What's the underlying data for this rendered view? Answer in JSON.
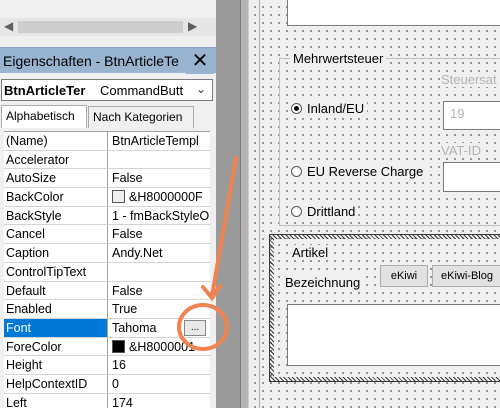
{
  "properties_panel": {
    "title": "Eigenschaften - BtnArticleTe",
    "object_name": "BtnArticleTer",
    "object_type": "CommandButt",
    "tabs": [
      "Alphabetisch",
      "Nach Kategorien"
    ],
    "rows": [
      {
        "name": "(Name)",
        "value": "BtnArticleTempl"
      },
      {
        "name": "Accelerator",
        "value": ""
      },
      {
        "name": "AutoSize",
        "value": "False"
      },
      {
        "name": "BackColor",
        "value": "&H8000000F",
        "swatch": "#f0f0f0"
      },
      {
        "name": "BackStyle",
        "value": "1 - fmBackStyleO"
      },
      {
        "name": "Cancel",
        "value": "False"
      },
      {
        "name": "Caption",
        "value": "Andy.Net"
      },
      {
        "name": "ControlTipText",
        "value": ""
      },
      {
        "name": "Default",
        "value": "False"
      },
      {
        "name": "Enabled",
        "value": "True"
      },
      {
        "name": "Font",
        "value": "Tahoma",
        "selected": true
      },
      {
        "name": "ForeColor",
        "value": "&H8000001",
        "swatch": "#000000"
      },
      {
        "name": "Height",
        "value": "16"
      },
      {
        "name": "HelpContextID",
        "value": "0"
      },
      {
        "name": "Left",
        "value": "174"
      }
    ],
    "ellipsis_label": "..."
  },
  "form": {
    "frame_tax": {
      "label": "Mehrwertsteuer",
      "options": [
        {
          "label": "Inland/EU",
          "checked": true
        },
        {
          "label": "EU Reverse Charge",
          "checked": false
        },
        {
          "label": "Drittland",
          "checked": false
        }
      ],
      "steuersatz_label": "Steuersat",
      "steuersatz_value": "19",
      "vatid_label": "VAT-ID"
    },
    "frame_article": {
      "label": "Artikel",
      "bezeichnung_label": "Bezeichnung",
      "buttons": [
        "eKiwi",
        "eKiwi-Blog"
      ]
    }
  },
  "colors": {
    "selection": "#0078d7",
    "titlebar": "#99b4d1",
    "annotation": "#f08350"
  }
}
